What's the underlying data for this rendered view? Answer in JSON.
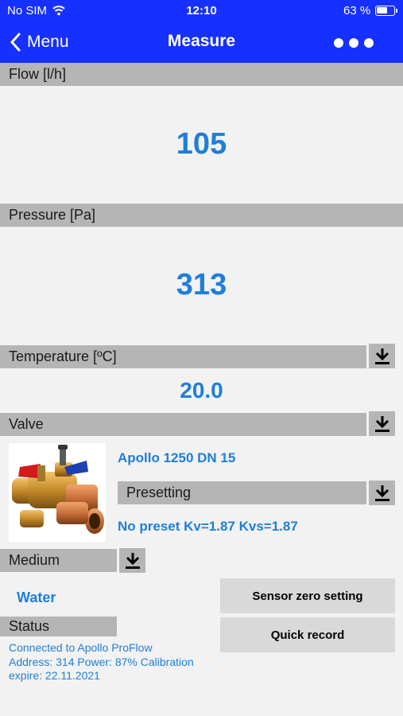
{
  "status_bar": {
    "carrier": "No SIM",
    "time": "12:10",
    "battery_percent": "63 %",
    "battery_level": 0.63
  },
  "nav": {
    "back_label": "Menu",
    "title": "Measure"
  },
  "flow": {
    "label": "Flow [l/h]",
    "value": "105"
  },
  "pressure": {
    "label": "Pressure [Pa]",
    "value": "313"
  },
  "temperature": {
    "label": "Temperature [ºC]",
    "value": "20.0"
  },
  "valve": {
    "label": "Valve",
    "name": "Apollo 1250 DN 15",
    "presetting_label": "Presetting",
    "preset_value": "No preset Kv=1.87 Kvs=1.87"
  },
  "medium": {
    "label": "Medium",
    "value": "Water"
  },
  "buttons": {
    "sensor_zero": "Sensor zero setting",
    "quick_record": "Quick record"
  },
  "status": {
    "label": "Status",
    "line1": "Connected to Apollo ProFlow",
    "line2": "Address: 314 Power: 87% Calibration",
    "line3": "expire: 22.11.2021"
  },
  "colors": {
    "nav_blue": "#1530ff",
    "value_blue": "#1f7ed9",
    "section_gray": "#b5b5b5",
    "button_gray": "#d9d9d9"
  }
}
